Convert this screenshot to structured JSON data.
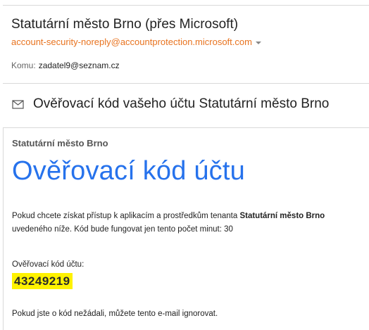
{
  "message": {
    "sender_display": "Statutární město Brno (přes Microsoft)",
    "sender_email": "account-security-noreply@accountprotection.microsoft.com",
    "to_label": "Komu:",
    "to_value": "zadatel9@seznam.cz",
    "subject": "Ověřovací kód vašeho účtu Statutární město Brno",
    "envelope_icon": "envelope-icon"
  },
  "body": {
    "org_name": "Statutární město Brno",
    "title": "Ověřovací kód účtu",
    "para_line1_prefix": "Pokud chcete získat přístup k aplikacím a prostředkům tenanta ",
    "para_line1_bold": "Statutární město Brno",
    "para_line2": "uvedeného níže. Kód bude fungovat jen tento počet minut: 30",
    "code_label": "Ověřovací kód účtu:",
    "code_value": "43249219",
    "ignore_text": "Pokud jste o kód nežádali, můžete tento e-mail ignorovat."
  },
  "colors": {
    "title_blue": "#2672ec",
    "sender_email_orange": "#e8731f",
    "code_highlight": "#fff200"
  }
}
